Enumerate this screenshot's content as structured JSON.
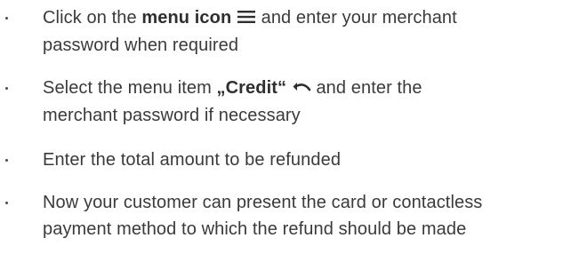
{
  "steps": [
    {
      "pre": "Click on the ",
      "bold": "menu icon",
      "icon": "hamburger-menu-icon",
      "post": " and enter your merchant",
      "line2": "password when required"
    },
    {
      "pre": "Select the menu item ",
      "bold": "„Credit“",
      "icon": "undo-arrow-icon",
      "post": " and enter the",
      "line2": "merchant password if necessary"
    },
    {
      "text": "Enter the total amount to be refunded"
    },
    {
      "line1": "Now your customer can present the card or contactless",
      "line2": "payment method to which the refund should be made"
    }
  ],
  "bullet_char": "•",
  "colors": {
    "text": "#3a3a3a",
    "bold": "#2f2f2f",
    "bullet": "#4a4a4a"
  }
}
